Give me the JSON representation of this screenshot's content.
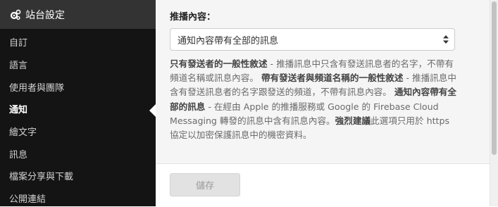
{
  "sidebar": {
    "header": {
      "icon": "gears-icon",
      "title": "站台設定"
    },
    "items": [
      {
        "label": "自訂",
        "active": false
      },
      {
        "label": "語言",
        "active": false
      },
      {
        "label": "使用者與團隊",
        "active": false
      },
      {
        "label": "通知",
        "active": true
      },
      {
        "label": "繪文字",
        "active": false
      },
      {
        "label": "訊息",
        "active": false
      },
      {
        "label": "檔案分享與下載",
        "active": false
      },
      {
        "label": "公開連結",
        "active": false
      }
    ]
  },
  "form": {
    "label": "推播內容：",
    "select_value": "通知內容帶有全部的訊息",
    "help": {
      "t1": "只有發送者的一般性敘述",
      "d1": " - 推播訊息中只含有發送訊息者的名字，不帶有頻道名稱或訊息內容。 ",
      "t2": "帶有發送者與頻道名稱的一般性敘述",
      "d2": " - 推播訊息中含有發送訊息者的名字跟發送的頻道，不帶有訊息內容。 ",
      "t3": "通知內容帶有全部的訊息",
      "d3": " - 在經由 Apple 的推播服務或 Google 的 Firebase Cloud Messaging 轉發的訊息中含有訊息內容。",
      "t4": "強烈建議",
      "d4": "此選項只用於 https 協定以加密保護訊息中的機密資料。"
    },
    "save_label": "儲存"
  },
  "colors": {
    "sidebar_bg": "#141414",
    "sidebar_header_bg": "#333333",
    "form_bg": "#f5f5f5"
  }
}
